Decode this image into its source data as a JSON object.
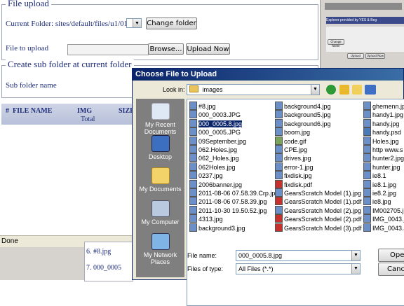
{
  "page": {
    "file_upload_legend": "File upload",
    "current_folder_label": "Current Folder: sites/default/files/u1/01",
    "folder_select_value": "",
    "change_folder_button": "Change folder",
    "file_to_upload_label": "File to upload",
    "browse_button": "Browse...",
    "upload_now_button": "Upload Now",
    "create_sub_legend": "Create sub folder at current folder",
    "sub_folder_label": "Sub folder name",
    "table_headers": {
      "hash": "#",
      "file_name": "FILE NAME",
      "img": "IMG",
      "img_total": "Total",
      "size": "SIZE"
    },
    "status_text": "Done",
    "thumb_rows": [
      "6. #8.jpg",
      "7. 000_0005"
    ]
  },
  "right_window": {
    "title_text": "Explorer provided by YES & Beg",
    "btn1": "Change folder",
    "btn2": "Upload",
    "btn3": "Upload Now"
  },
  "dialog": {
    "title": "Choose File to Upload",
    "look_in_label": "Look in:",
    "look_in_value": "images",
    "places": [
      {
        "label": "My Recent Documents",
        "icon": "recent-docs-icon"
      },
      {
        "label": "Desktop",
        "icon": "desktop-icon"
      },
      {
        "label": "My Documents",
        "icon": "my-documents-icon"
      },
      {
        "label": "My Computer",
        "icon": "my-computer-icon"
      },
      {
        "label": "My Network Places",
        "icon": "network-places-icon"
      }
    ],
    "files_col1": [
      "#8.jpg",
      "000_0003.JPG",
      "000_0005.8.jpg",
      "000_0005.JPG",
      "09September.jpg",
      "062.Holes.jpg",
      "062_Holes.jpg",
      "062Holes.jpg",
      "0237.jpg",
      "2006banner.jpg",
      "2011-08-06 07.58.39.Crp.jpg",
      "2011-08-06 07.58.39.jpg",
      "2011-10-30 19.50.52.jpg",
      "4313.jpg",
      "background3.jpg"
    ],
    "files_col2": [
      "background4.jpg",
      "background5.jpg",
      "background6.jpg",
      "boom.jpg",
      "code.gif",
      "CPE.jpg",
      "drives.jpg",
      "error-1.jpg",
      "fixdisk.jpg",
      "fixdisk.pdf",
      "GearsScratch Model (1).jpg",
      "GearsScratch Model (1).pdf",
      "GearsScratch Model (2).jpg",
      "GearsScratch Model (2).pdf",
      "GearsScratch Model (3).pdf"
    ],
    "files_col3": [
      "ghemenn.jpg",
      "handy1.jpg",
      "handy.jpg",
      "handy.psd",
      "Holes.jpg",
      "http  www.s",
      "hunter2.jpg",
      "hunter.jpg",
      "ie8.1",
      "ie8.1.jpg",
      "ie8.2.jpg",
      "ie8.jpg",
      "IM002705.jp",
      "IMG_0043.jp",
      "IMG_0043.JP"
    ],
    "selected_file": "000_0005.8.jpg",
    "file_name_label": "File name:",
    "file_name_value": "000_0005.8.jpg",
    "files_of_type_label": "Files of type:",
    "files_of_type_value": "All Files (*.*)",
    "open_button": "Open",
    "cancel_button": "Cancel"
  },
  "colors": {
    "title_blue": "#0a246a",
    "label_navy": "#1e2d7a",
    "dialog_bg": "#ece9d8",
    "places_bg": "#7f7f7f"
  }
}
